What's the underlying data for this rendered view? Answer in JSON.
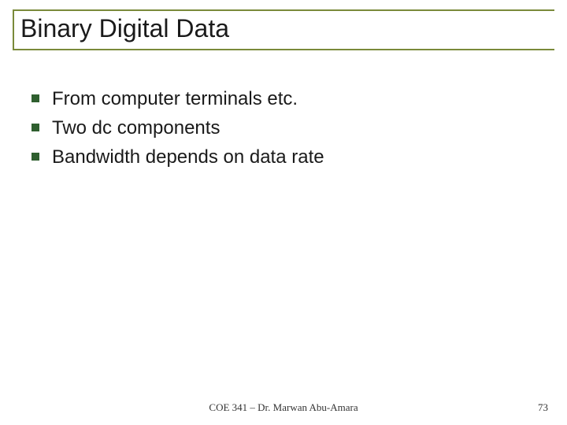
{
  "title": "Binary Digital Data",
  "bullets": [
    "From computer terminals etc.",
    "Two dc components",
    "Bandwidth depends on data rate"
  ],
  "footer": {
    "center": "COE 341 – Dr. Marwan Abu-Amara",
    "page": "73"
  }
}
